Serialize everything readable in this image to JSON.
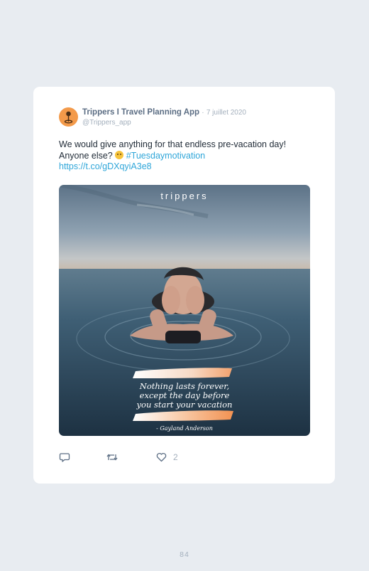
{
  "tweet": {
    "display_name": "Trippers I Travel Planning App",
    "separator": "·",
    "date": "7 juillet 2020",
    "handle": "@Trippers_app",
    "text_line1": "We would give anything for that endless pre-vacation day!",
    "text_line2_prefix": "Anyone else?",
    "emoji": "upside-down-face-emoji",
    "hashtag": "#Tuesdaymotivation",
    "link": "https://t.co/gDXqyiA3e8"
  },
  "media": {
    "logo_text": "trippers",
    "quote_lines": [
      "Nothing lasts forever,",
      "except the day before",
      "you start your vacation"
    ],
    "attribution": "- Gayland Anderson"
  },
  "actions": {
    "reply_icon": "reply-icon",
    "retweet_icon": "retweet-icon",
    "like_icon": "heart-icon",
    "like_count": "2"
  },
  "page": {
    "number": "84"
  },
  "colors": {
    "background": "#e8ecf1",
    "card": "#ffffff",
    "avatar": "#f39a4a",
    "link": "#2fa6d9",
    "name": "#5c6e84",
    "muted": "#a4b0bd"
  }
}
